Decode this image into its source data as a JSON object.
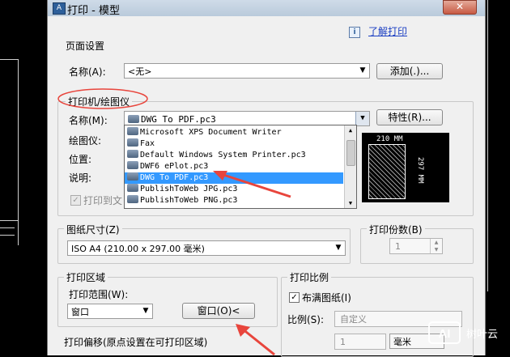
{
  "window": {
    "title": "打印 - 模型",
    "close": "✕"
  },
  "help": {
    "icon": "i",
    "link": "了解打印"
  },
  "page_setup": {
    "section": "页面设置",
    "name_label": "名称(A):",
    "name_value": "<无>",
    "add_button": "添加(.)..."
  },
  "printer": {
    "section": "打印机/绘图仪",
    "name_label": "名称(M):",
    "name_value": "DWG To PDF.pc3",
    "properties_button": "特性(R)...",
    "plotter_label": "绘图仪:",
    "location_label": "位置:",
    "description_label": "说明:",
    "print_to_file_label": "打印到文",
    "print_to_file_checked": true,
    "dropdown_items": [
      "Microsoft XPS Document Writer",
      "Fax",
      "Default Windows System Printer.pc3",
      "DWF6 ePlot.pc3",
      "DWG To PDF.pc3",
      "PublishToWeb JPG.pc3",
      "PublishToWeb PNG.pc3"
    ],
    "selected_index": 4,
    "preview_width": "210 MM",
    "preview_height": "297 MM"
  },
  "paper_size": {
    "section": "图纸尺寸(Z)",
    "value": "ISO A4 (210.00 x 297.00 毫米)"
  },
  "copies": {
    "section": "打印份数(B)",
    "value": "1"
  },
  "plot_area": {
    "section": "打印区域",
    "range_label": "打印范围(W):",
    "range_value": "窗口",
    "window_button": "窗口(O)<"
  },
  "plot_scale": {
    "section": "打印比例",
    "fit_label": "布满图纸(I)",
    "fit_checked": true,
    "scale_label": "比例(S):",
    "scale_value": "自定义",
    "scale_num": "1",
    "unit_value": "毫米"
  },
  "plot_offset": {
    "section": "打印偏移(原点设置在可打印区域)"
  },
  "watermark": {
    "logo": "AI",
    "text": "树叶云"
  },
  "colors": {
    "selection": "#3399ff",
    "annotation": "#e8453c",
    "link": "#1a3ec2"
  }
}
